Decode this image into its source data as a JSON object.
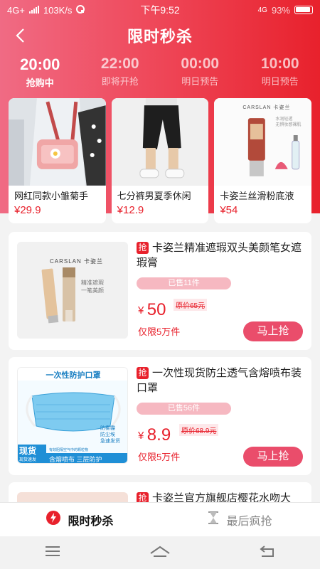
{
  "status_bar": {
    "network": "4G+",
    "speed": "103K/s",
    "time": "下午9:52",
    "signal2": "4G",
    "battery": "93%"
  },
  "header": {
    "back_icon": "chevron-left-icon",
    "title": "限时秒杀"
  },
  "time_tabs": [
    {
      "time": "20:00",
      "status": "抢购中",
      "active": true
    },
    {
      "time": "22:00",
      "status": "即将开抢",
      "active": false
    },
    {
      "time": "00:00",
      "status": "明日预告",
      "active": false
    },
    {
      "time": "10:00",
      "status": "明日预告",
      "active": false
    }
  ],
  "top_products": [
    {
      "name": "网红同款小雏菊手",
      "price": "¥29.9"
    },
    {
      "name": "七分裤男夏季休闲",
      "price": "¥12.9"
    },
    {
      "name": "卡姿兰丝滑粉底液",
      "price": "¥54",
      "image_brand": "CARSLAN 卡姿兰",
      "image_caption": "水润轻透\n无惧妆感裸肌"
    }
  ],
  "list_products": [
    {
      "tag": "抢",
      "title": "卡姿兰精准遮瑕双头美颜笔女遮瑕膏",
      "sold": "已售11件",
      "yen": "¥",
      "price": "50",
      "original": "原价65元",
      "limit": "仅限5万件",
      "button": "马上抢",
      "image_brand": "CARSLAN 卡姿兰",
      "image_caption": "精准遮瑕\n一笔美颜"
    },
    {
      "tag": "抢",
      "title": "一次性现货防尘透气含熔喷布装口罩",
      "sold": "已售56件",
      "yen": "¥",
      "price": "8.9",
      "original": "原价68.9元",
      "limit": "仅限5万件",
      "button": "马上抢",
      "image_header": "一次性防护口罩",
      "image_tags": [
        "防雾霾",
        "防尘埃"
      ],
      "image_badge": "现货",
      "image_badge_sub": "现货速发",
      "image_ship": "急速发货",
      "image_note": "有效阻隔空气中的颗粒物",
      "image_footer": "含熔喷布 三层防护"
    },
    {
      "tag": "抢",
      "title": "卡姿兰官方旗舰店樱花水吻大"
    }
  ],
  "bottom_tabs": [
    {
      "label": "限时秒杀",
      "icon": "lightning-icon",
      "active": true
    },
    {
      "label": "最后疯抢",
      "icon": "hourglass-icon",
      "active": false
    }
  ],
  "system_nav": [
    "menu-icon",
    "home-icon",
    "back-icon"
  ]
}
